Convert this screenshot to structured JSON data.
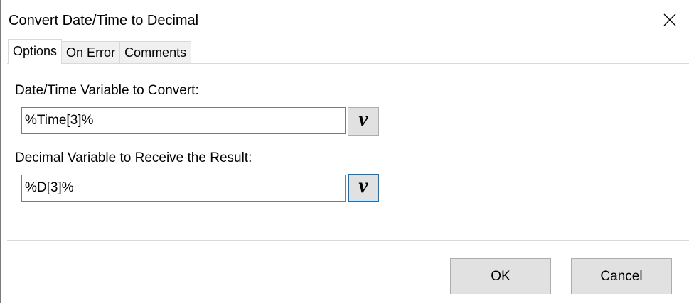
{
  "window": {
    "title": "Convert Date/Time to Decimal",
    "close_icon": "close-icon"
  },
  "tabs": [
    {
      "label": "Options",
      "active": true
    },
    {
      "label": "On Error",
      "active": false
    },
    {
      "label": "Comments",
      "active": false
    }
  ],
  "options": {
    "datetime_label": "Date/Time Variable to Convert:",
    "datetime_value": "%Time[3]%",
    "datetime_var_button": "v",
    "decimal_label": "Decimal Variable to Receive the Result:",
    "decimal_value": "%D[3]%",
    "decimal_var_button": "v"
  },
  "footer": {
    "ok_label": "OK",
    "cancel_label": "Cancel"
  },
  "colors": {
    "focus_border": "#0078d7",
    "button_face": "#e1e1e1"
  }
}
